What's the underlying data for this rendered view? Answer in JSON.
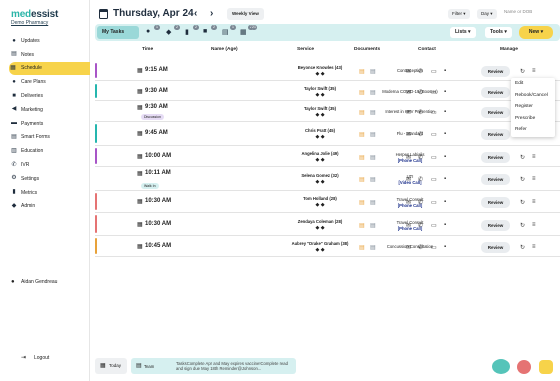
{
  "app": {
    "logo_med": "med",
    "logo_essist": "essist",
    "pharmacy": "Demo Pharmacy"
  },
  "sidebar": {
    "items": [
      {
        "label": "Updates",
        "icon": "lightbulb-icon"
      },
      {
        "label": "Notes",
        "icon": "notes-icon"
      },
      {
        "label": "Schedule",
        "icon": "calendar-icon",
        "active": true
      },
      {
        "label": "Care Plans",
        "icon": "people-icon"
      },
      {
        "label": "Deliveries",
        "icon": "truck-icon"
      },
      {
        "label": "Marketing",
        "icon": "megaphone-icon"
      },
      {
        "label": "Payments",
        "icon": "credit-card-icon"
      },
      {
        "label": "Smart Forms",
        "icon": "forms-icon"
      },
      {
        "label": "Education",
        "icon": "book-icon"
      },
      {
        "label": "IVR",
        "icon": "phone-icon"
      },
      {
        "label": "Settings",
        "icon": "gear-icon"
      },
      {
        "label": "Metrics",
        "icon": "chart-icon"
      },
      {
        "label": "Admin",
        "icon": "admin-icon"
      }
    ],
    "user": "Aidan Gendreau",
    "logout": "Logout"
  },
  "header": {
    "date": "Thursday, Apr 24",
    "prev": "‹",
    "next": "›",
    "weekly": "Weekly View",
    "filter": "Filter ▾",
    "day": "Day ▾",
    "search_placeholder": "Name or DOB"
  },
  "tabs": {
    "my_tasks": "My Tasks",
    "badges": [
      "1",
      "2",
      "2",
      "2",
      "1",
      "2",
      "21"
    ],
    "lists": "Lists ▾",
    "tools": "Tools ▾",
    "new": "New ▾"
  },
  "table": {
    "headers": {
      "time": "Time",
      "name": "Name (Age)",
      "service": "Service",
      "documents": "Documents",
      "contact": "Contact",
      "manage": "Manage"
    },
    "review_label": "Review",
    "rows": [
      {
        "time": "9:15 AM",
        "name": "Beyonce Knowles (43)",
        "service": "Contraception",
        "phone": "",
        "stripe": "#a855c7",
        "tag": ""
      },
      {
        "time": "9:30 AM",
        "name": "Taylor Swift (35)",
        "service": "Moderna COVID-19 (Booster)",
        "phone": "",
        "stripe": "#25b6ae",
        "tag": ""
      },
      {
        "time": "9:30 AM",
        "name": "Taylor Swift (35)",
        "service": "Interest in HPV Prevention",
        "phone": "",
        "stripe": "",
        "tag": "Discussion"
      },
      {
        "time": "9:45 AM",
        "name": "Chris Pratt (45)",
        "service": "Flu - Standard",
        "phone": "",
        "stripe": "#25b6ae",
        "tag": ""
      },
      {
        "time": "10:00 AM",
        "name": "Angelina Jolie (49)",
        "service": "Herpes Labialis",
        "phone": "[Phone Call]",
        "stripe": "#a855c7",
        "tag": ""
      },
      {
        "time": "10:11 AM",
        "name": "Selena Gomez (32)",
        "service": "UTI",
        "phone": "[Video Call]",
        "stripe": "",
        "tag": "Walk In"
      },
      {
        "time": "10:30 AM",
        "name": "Tom Holland (28)",
        "service": "Travel Consult",
        "phone": "[Phone Call]",
        "stripe": "#e57373",
        "tag": ""
      },
      {
        "time": "10:30 AM",
        "name": "Zendaya Coleman (28)",
        "service": "Travel Consult",
        "phone": "[Phone Call]",
        "stripe": "#e57373",
        "tag": ""
      },
      {
        "time": "10:45 AM",
        "name": "Aubrey \"Drake\" Graham (38)",
        "service": "Concussion Consultation",
        "phone": "",
        "stripe": "#e8a23a",
        "tag": ""
      }
    ]
  },
  "context_menu": [
    "Edit",
    "Rebook/Cancel",
    "Register",
    "Prescribe",
    "Refer"
  ],
  "footer": {
    "today": "Today",
    "team": "Team",
    "message": "TasksComplete Apr and May expires vaccine!Complete read and sign due May 18th Reminder@Johnson..."
  },
  "colors": {
    "accent": "#f7d34a",
    "teal": "#25b6ae",
    "teal_light": "#d6f0f0"
  }
}
